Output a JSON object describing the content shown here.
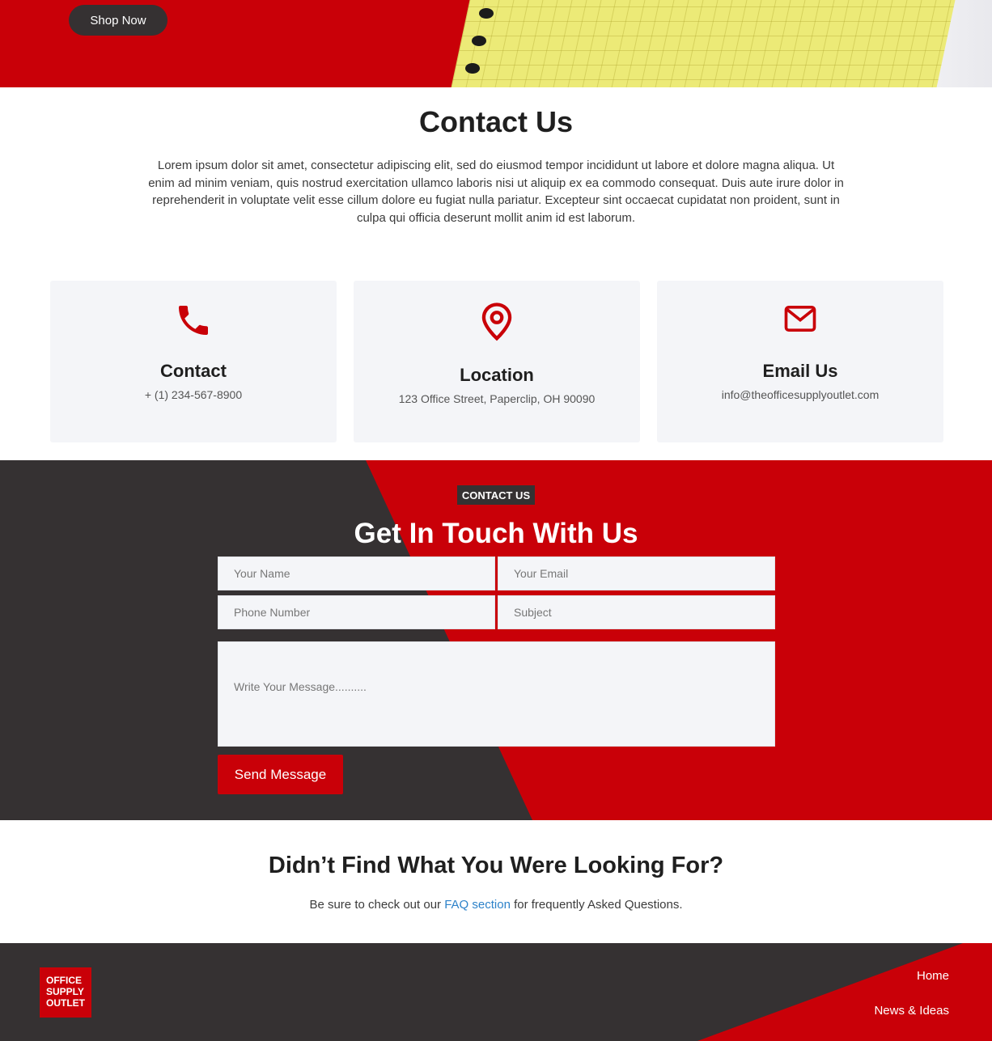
{
  "hero": {
    "shop_button": "Shop Now"
  },
  "contact": {
    "title": "Contact Us",
    "intro": "Lorem ipsum dolor sit amet, consectetur adipiscing elit, sed do eiusmod tempor incididunt ut labore et dolore magna aliqua. Ut enim ad minim veniam, quis nostrud exercitation ullamco laboris nisi ut aliquip ex ea commodo consequat. Duis aute irure dolor in reprehenderit in voluptate velit esse cillum dolore eu fugiat nulla pariatur. Excepteur sint occaecat cupidatat non proident, sunt in culpa qui officia deserunt mollit anim id est laborum.",
    "cards": [
      {
        "icon": "phone-icon",
        "title": "Contact",
        "value": "+ (1) 234-567-8900"
      },
      {
        "icon": "location-pin-icon",
        "title": "Location",
        "value": "123 Office Street, Paperclip, OH 90090"
      },
      {
        "icon": "envelope-icon",
        "title": "Email Us",
        "value": "info@theofficesupplyoutlet.com"
      }
    ]
  },
  "form": {
    "tag": "CONTACT US",
    "title": "Get In Touch With Us",
    "name_placeholder": "Your Name",
    "email_placeholder": "Your Email",
    "phone_placeholder": "Phone Number",
    "subject_placeholder": "Subject",
    "message_placeholder": "Write Your Message..........",
    "send_label": "Send Message"
  },
  "faq": {
    "title": "Didn’t Find What You Were Looking For?",
    "text_before": "Be sure to check out our ",
    "link_text": "FAQ section",
    "text_after": " for frequently Asked Questions."
  },
  "footer": {
    "logo_line1": "OFFICE",
    "logo_line2": "SUPPLY",
    "logo_line3": "OUTLET",
    "nav": [
      "Home",
      "News & Ideas"
    ]
  },
  "colors": {
    "brand_red": "#c90008",
    "dark": "#353132",
    "card_bg": "#f4f5f8",
    "link": "#2d82c9"
  }
}
